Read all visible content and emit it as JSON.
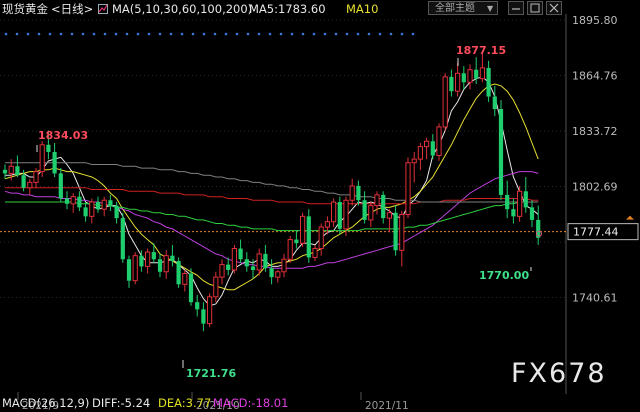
{
  "header": {
    "instrument": "现货黄金",
    "period": "<日线>",
    "ma_settings": "MA(5,10,30,60,100,200)",
    "ma5_label": "MA5:1783.60",
    "ma10_label": "MA10",
    "subject_select": "全部主题"
  },
  "colors": {
    "background": "#000000",
    "up": "#e0303a",
    "down": "#1fce6e",
    "ma5": "#e8e8e8",
    "ma10": "#e8e030",
    "ma30": "#c040e0",
    "ma60": "#30d040",
    "ma100": "#d02020",
    "ma200": "#808080",
    "last_price": "#e08020",
    "dots": "#3a78d8",
    "macd_yellow": "#e0e020",
    "macd_magenta": "#e040e0"
  },
  "icons": [
    "grid-icon",
    "minus-icon",
    "settings-icon",
    "close-icon",
    "search-dots-icon"
  ],
  "chart_data": {
    "type": "candlestick",
    "title": "现货黄金 <日线>",
    "x_labels": [
      "2021/9",
      "2021/10",
      "2021/11"
    ],
    "y_ticks": [
      1895.8,
      1864.76,
      1833.72,
      1802.69,
      1771.65,
      1740.61
    ],
    "y_tick_labels": [
      "1895.80",
      "1864.76",
      "1833.72",
      "1802.69",
      "1740.61"
    ],
    "ylim": [
      1718,
      1898
    ],
    "last_price": 1777.44,
    "last_price_label": "1777.44",
    "annotations": [
      {
        "label": "1834.03",
        "value": 1834.03,
        "kind": "high"
      },
      {
        "label": "1721.76",
        "value": 1721.76,
        "kind": "low"
      },
      {
        "label": "1877.15",
        "value": 1877.15,
        "kind": "high"
      },
      {
        "label": "1770.00",
        "value": 1770.0,
        "kind": "low"
      }
    ],
    "candles": [
      [
        1812,
        1815,
        1807,
        1810
      ],
      [
        1810,
        1818,
        1806,
        1814
      ],
      [
        1814,
        1820,
        1808,
        1809
      ],
      [
        1809,
        1812,
        1800,
        1802
      ],
      [
        1802,
        1807,
        1798,
        1805
      ],
      [
        1805,
        1813,
        1802,
        1811
      ],
      [
        1811,
        1828,
        1808,
        1826
      ],
      [
        1826,
        1834.03,
        1818,
        1822
      ],
      [
        1822,
        1827,
        1808,
        1810
      ],
      [
        1810,
        1813,
        1794,
        1796
      ],
      [
        1796,
        1800,
        1790,
        1793
      ],
      [
        1793,
        1799,
        1788,
        1797
      ],
      [
        1797,
        1800,
        1789,
        1791
      ],
      [
        1791,
        1794,
        1783,
        1786
      ],
      [
        1786,
        1796,
        1782,
        1794
      ],
      [
        1794,
        1797,
        1788,
        1790
      ],
      [
        1790,
        1797,
        1786,
        1795
      ],
      [
        1795,
        1798,
        1789,
        1792
      ],
      [
        1792,
        1794,
        1782,
        1785
      ],
      [
        1785,
        1788,
        1760,
        1762
      ],
      [
        1762,
        1764,
        1746,
        1750
      ],
      [
        1750,
        1766,
        1748,
        1764
      ],
      [
        1764,
        1767,
        1755,
        1758
      ],
      [
        1758,
        1768,
        1754,
        1766
      ],
      [
        1766,
        1771,
        1760,
        1762
      ],
      [
        1762,
        1765,
        1752,
        1755
      ],
      [
        1755,
        1767,
        1751,
        1764
      ],
      [
        1764,
        1770,
        1758,
        1761
      ],
      [
        1761,
        1763,
        1746,
        1748
      ],
      [
        1748,
        1756,
        1744,
        1754
      ],
      [
        1754,
        1757,
        1736,
        1738
      ],
      [
        1738,
        1742,
        1730,
        1734
      ],
      [
        1734,
        1738,
        1721.76,
        1726
      ],
      [
        1726,
        1743,
        1724,
        1741
      ],
      [
        1741,
        1755,
        1738,
        1752
      ],
      [
        1752,
        1762,
        1748,
        1759
      ],
      [
        1759,
        1763,
        1753,
        1756
      ],
      [
        1756,
        1770,
        1754,
        1768
      ],
      [
        1768,
        1773,
        1760,
        1762
      ],
      [
        1762,
        1766,
        1755,
        1758
      ],
      [
        1758,
        1762,
        1751,
        1756
      ],
      [
        1756,
        1768,
        1753,
        1765
      ],
      [
        1765,
        1770,
        1755,
        1757
      ],
      [
        1757,
        1762,
        1748,
        1752
      ],
      [
        1752,
        1756,
        1749,
        1755
      ],
      [
        1755,
        1765,
        1752,
        1762
      ],
      [
        1762,
        1775,
        1760,
        1773
      ],
      [
        1773,
        1778,
        1768,
        1771
      ],
      [
        1771,
        1788,
        1769,
        1786
      ],
      [
        1786,
        1790,
        1760,
        1763
      ],
      [
        1763,
        1770,
        1761,
        1768
      ],
      [
        1768,
        1782,
        1764,
        1780
      ],
      [
        1780,
        1786,
        1776,
        1783
      ],
      [
        1783,
        1796,
        1780,
        1794
      ],
      [
        1794,
        1797,
        1776,
        1779
      ],
      [
        1779,
        1797,
        1775,
        1795
      ],
      [
        1795,
        1807,
        1792,
        1803
      ],
      [
        1803,
        1806,
        1792,
        1795
      ],
      [
        1795,
        1800,
        1782,
        1784
      ],
      [
        1784,
        1794,
        1780,
        1792
      ],
      [
        1792,
        1800,
        1787,
        1798
      ],
      [
        1798,
        1800,
        1782,
        1785
      ],
      [
        1785,
        1790,
        1777,
        1788
      ],
      [
        1788,
        1792,
        1764,
        1767
      ],
      [
        1767,
        1789,
        1758,
        1787
      ],
      [
        1787,
        1819,
        1785,
        1816
      ],
      [
        1816,
        1822,
        1805,
        1818
      ],
      [
        1818,
        1827,
        1812,
        1825
      ],
      [
        1825,
        1830,
        1818,
        1828
      ],
      [
        1828,
        1832,
        1818,
        1820
      ],
      [
        1820,
        1838,
        1817,
        1836
      ],
      [
        1836,
        1866,
        1834,
        1864
      ],
      [
        1864,
        1868,
        1853,
        1856
      ],
      [
        1856,
        1872,
        1853,
        1866
      ],
      [
        1866,
        1870,
        1857,
        1861
      ],
      [
        1861,
        1871,
        1857,
        1868
      ],
      [
        1868,
        1875,
        1860,
        1863
      ],
      [
        1863,
        1877.15,
        1861,
        1869
      ],
      [
        1869,
        1873,
        1850,
        1853
      ],
      [
        1853,
        1859,
        1842,
        1846
      ],
      [
        1846,
        1851,
        1795,
        1798
      ],
      [
        1798,
        1806,
        1785,
        1790
      ],
      [
        1790,
        1796,
        1782,
        1786
      ],
      [
        1786,
        1803,
        1783,
        1800
      ],
      [
        1800,
        1808,
        1788,
        1791
      ],
      [
        1791,
        1795,
        1780,
        1784
      ],
      [
        1784,
        1792,
        1770,
        1774
      ]
    ],
    "ma_series": [
      {
        "name": "MA5",
        "values": [
          1809,
          1809,
          1810,
          1810,
          1808,
          1808,
          1812,
          1817,
          1818,
          1819,
          1815,
          1810,
          1802,
          1794,
          1792,
          1790,
          1791,
          1792,
          1792,
          1786,
          1776,
          1770,
          1764,
          1760,
          1760,
          1760,
          1761,
          1762,
          1759,
          1756,
          1753,
          1746,
          1740,
          1736,
          1737,
          1742,
          1750,
          1757,
          1759,
          1761,
          1760,
          1762,
          1761,
          1758,
          1758,
          1759,
          1762,
          1767,
          1771,
          1771,
          1770,
          1774,
          1777,
          1778,
          1783,
          1786,
          1790,
          1794,
          1793,
          1794,
          1793,
          1791,
          1789,
          1786,
          1785,
          1792,
          1795,
          1800,
          1806,
          1820,
          1826,
          1834,
          1845,
          1850,
          1857,
          1861,
          1863,
          1864,
          1861,
          1853,
          1839,
          1823,
          1808,
          1800,
          1792,
          1790,
          1787
        ]
      },
      {
        "name": "MA10",
        "values": [
          1807,
          1808,
          1809,
          1810,
          1811,
          1811,
          1812,
          1812,
          1813,
          1812,
          1811,
          1811,
          1810,
          1809,
          1808,
          1806,
          1803,
          1799,
          1796,
          1790,
          1785,
          1780,
          1776,
          1773,
          1770,
          1765,
          1763,
          1761,
          1759,
          1757,
          1755,
          1753,
          1750,
          1748,
          1747,
          1746,
          1745,
          1745,
          1747,
          1749,
          1751,
          1754,
          1758,
          1759,
          1760,
          1760,
          1761,
          1762,
          1764,
          1765,
          1766,
          1768,
          1771,
          1774,
          1776,
          1778,
          1780,
          1783,
          1786,
          1788,
          1790,
          1791,
          1791,
          1792,
          1793,
          1795,
          1797,
          1800,
          1804,
          1808,
          1814,
          1820,
          1826,
          1833,
          1840,
          1846,
          1852,
          1856,
          1859,
          1860,
          1859,
          1856,
          1851,
          1844,
          1836,
          1827,
          1818
        ]
      },
      {
        "name": "MA30",
        "values": [
          1800,
          1799,
          1799,
          1798,
          1798,
          1797,
          1797,
          1797,
          1797,
          1796,
          1796,
          1796,
          1795,
          1795,
          1794,
          1794,
          1793,
          1792,
          1791,
          1790,
          1789,
          1787,
          1786,
          1785,
          1783,
          1782,
          1780,
          1779,
          1777,
          1775,
          1773,
          1771,
          1769,
          1767,
          1765,
          1764,
          1762,
          1761,
          1760,
          1759,
          1759,
          1758,
          1758,
          1757,
          1757,
          1757,
          1757,
          1757,
          1757,
          1758,
          1758,
          1759,
          1760,
          1760,
          1761,
          1762,
          1763,
          1764,
          1765,
          1766,
          1767,
          1768,
          1769,
          1770,
          1771,
          1773,
          1775,
          1777,
          1779,
          1781,
          1784,
          1787,
          1790,
          1793,
          1796,
          1799,
          1801,
          1803,
          1805,
          1807,
          1808,
          1809,
          1810,
          1811,
          1811,
          1811,
          1810
        ]
      },
      {
        "name": "MA60",
        "values": [
          1794,
          1794,
          1794,
          1794,
          1794,
          1794,
          1794,
          1794,
          1794,
          1794,
          1794,
          1794,
          1793,
          1793,
          1793,
          1792,
          1792,
          1792,
          1791,
          1791,
          1790,
          1790,
          1789,
          1789,
          1788,
          1788,
          1787,
          1787,
          1786,
          1786,
          1785,
          1784,
          1784,
          1783,
          1782,
          1782,
          1781,
          1781,
          1780,
          1780,
          1779,
          1779,
          1779,
          1779,
          1778,
          1778,
          1778,
          1778,
          1778,
          1778,
          1778,
          1778,
          1778,
          1778,
          1778,
          1778,
          1778,
          1778,
          1779,
          1779,
          1779,
          1779,
          1779,
          1779,
          1779,
          1780,
          1780,
          1781,
          1781,
          1782,
          1783,
          1784,
          1785,
          1786,
          1787,
          1788,
          1789,
          1790,
          1791,
          1792,
          1792,
          1793,
          1793,
          1794,
          1794,
          1794,
          1794
        ]
      },
      {
        "name": "MA100",
        "values": [
          1802,
          1802,
          1802,
          1802,
          1802,
          1802,
          1802,
          1802,
          1802,
          1802,
          1802,
          1802,
          1802,
          1802,
          1801,
          1801,
          1801,
          1801,
          1801,
          1801,
          1800,
          1800,
          1800,
          1800,
          1800,
          1799,
          1799,
          1799,
          1799,
          1798,
          1798,
          1798,
          1798,
          1797,
          1797,
          1797,
          1796,
          1796,
          1796,
          1796,
          1795,
          1795,
          1795,
          1795,
          1794,
          1794,
          1794,
          1794,
          1794,
          1793,
          1793,
          1793,
          1793,
          1793,
          1793,
          1793,
          1793,
          1793,
          1793,
          1793,
          1793,
          1793,
          1793,
          1793,
          1793,
          1793,
          1793,
          1794,
          1794,
          1794,
          1794,
          1795,
          1795,
          1795,
          1795,
          1796,
          1796,
          1796,
          1796,
          1796,
          1796,
          1796,
          1796,
          1796,
          1796,
          1795,
          1795
        ]
      },
      {
        "name": "MA200",
        "values": [
          1816,
          1816,
          1816,
          1816,
          1816,
          1816,
          1816,
          1816,
          1816,
          1816,
          1816,
          1816,
          1816,
          1816,
          1815,
          1815,
          1815,
          1815,
          1815,
          1814,
          1814,
          1814,
          1813,
          1813,
          1813,
          1812,
          1812,
          1812,
          1811,
          1811,
          1810,
          1810,
          1809,
          1809,
          1808,
          1808,
          1807,
          1807,
          1806,
          1806,
          1805,
          1805,
          1804,
          1804,
          1803,
          1803,
          1802,
          1802,
          1801,
          1801,
          1800,
          1800,
          1799,
          1799,
          1798,
          1798,
          1798,
          1797,
          1797,
          1797,
          1796,
          1796,
          1796,
          1795,
          1795,
          1795,
          1795,
          1794,
          1794,
          1794,
          1794,
          1794,
          1794,
          1794,
          1794,
          1794,
          1794,
          1794,
          1794,
          1794,
          1794,
          1794,
          1794,
          1794,
          1794,
          1794,
          1794
        ]
      }
    ]
  },
  "macd": {
    "label": "MACD(26,12,9)",
    "diff": "DIFF:-5.24",
    "dea": "DEA:3.77",
    "macd": "MACD:-18.01"
  }
}
